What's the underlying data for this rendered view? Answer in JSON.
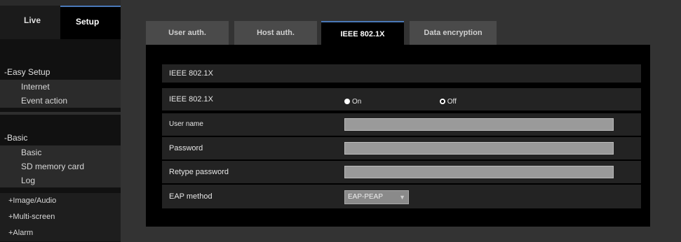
{
  "top_tabs": {
    "live": "Live",
    "setup": "Setup"
  },
  "sidebar": {
    "easy_setup": {
      "head": "-Easy Setup",
      "items": [
        "Internet",
        "Event action"
      ]
    },
    "basic": {
      "head": "-Basic",
      "items": [
        "Basic",
        "SD memory card",
        "Log"
      ]
    },
    "collapsed": [
      "+Image/Audio",
      "+Multi-screen",
      "+Alarm"
    ]
  },
  "tabs": [
    "User auth.",
    "Host auth.",
    "IEEE 802.1X",
    "Data encryption"
  ],
  "active_tab": "IEEE 802.1X",
  "section_title": "IEEE 802.1X",
  "form": {
    "ieee_label": "IEEE 802.1X",
    "on_label": "On",
    "off_label": "Off",
    "selected": "Off",
    "user_name_label": "User name",
    "user_name_value": "",
    "password_label": "Password",
    "password_value": "",
    "retype_label": "Retype password",
    "retype_value": "",
    "eap_label": "EAP method",
    "eap_value": "EAP-PEAP"
  }
}
